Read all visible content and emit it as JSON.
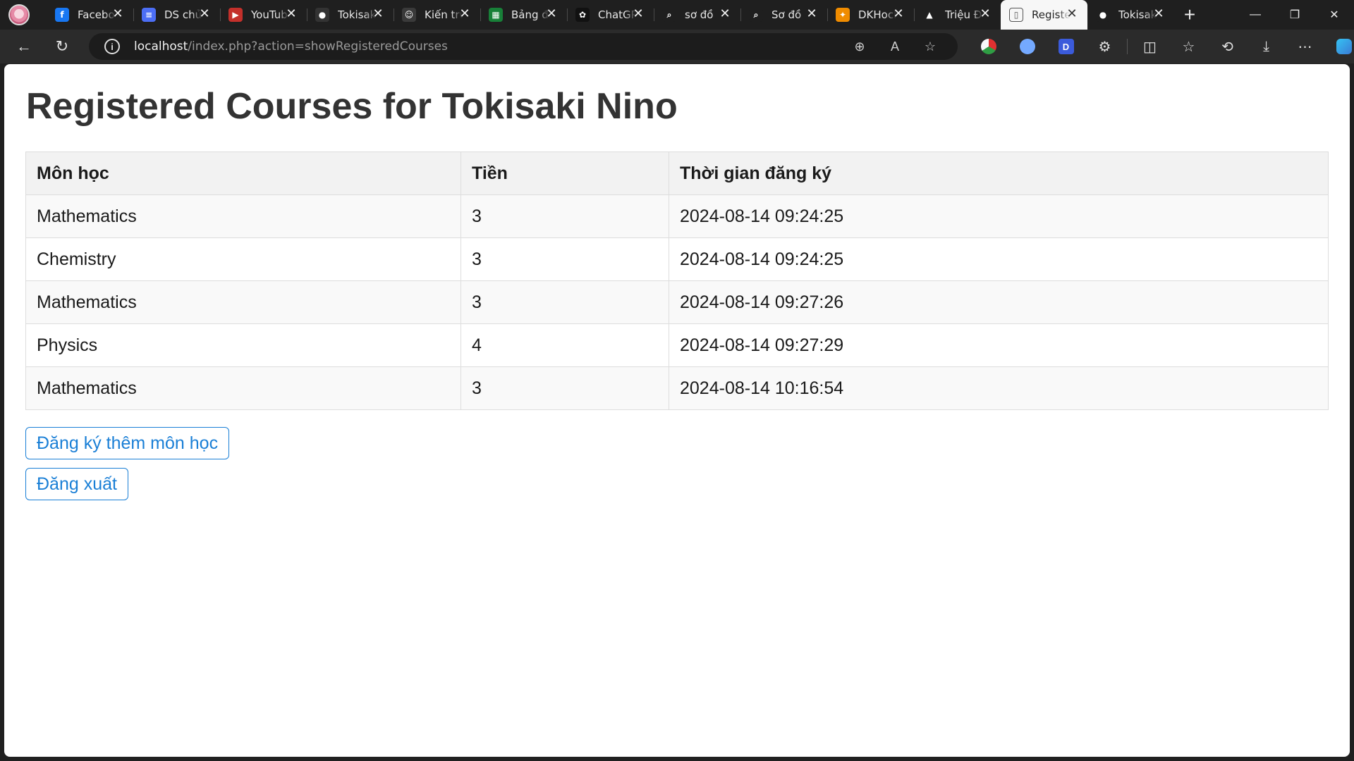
{
  "browser": {
    "tabs": [
      {
        "title": "Facebook",
        "icon": "facebook-icon",
        "color": "#1877f2",
        "glyph": "f"
      },
      {
        "title": "DS chủ",
        "icon": "docs-icon",
        "color": "#4c6ef5",
        "glyph": "≡"
      },
      {
        "title": "YouTube",
        "icon": "youtube-icon",
        "color": "#c4302b",
        "glyph": "▶"
      },
      {
        "title": "Tokisaki",
        "icon": "github-icon",
        "color": "#333333",
        "glyph": "●"
      },
      {
        "title": "Kiến trúc",
        "icon": "discord-icon",
        "color": "#3a3a3a",
        "glyph": "☺"
      },
      {
        "title": "Bảng điểm",
        "icon": "sheets-icon",
        "color": "#188038",
        "glyph": "▦"
      },
      {
        "title": "ChatGPT",
        "icon": "chatgpt-icon",
        "color": "#111111",
        "glyph": "✿"
      },
      {
        "title": "sơ đồ",
        "icon": "search-icon",
        "color": "#1f1f1f",
        "glyph": "⌕"
      },
      {
        "title": "Sơ đồ",
        "icon": "search-icon",
        "color": "#1f1f1f",
        "glyph": "⌕"
      },
      {
        "title": "DKHocPhan",
        "icon": "dkhp-icon",
        "color": "#f08c00",
        "glyph": "✦"
      },
      {
        "title": "Triệu Đô",
        "icon": "drive-icon",
        "color": "#1f1f1f",
        "glyph": "▲"
      },
      {
        "title": "Registered",
        "icon": "page-icon",
        "color": "#f7f7f7",
        "glyph": "▯",
        "active": true
      },
      {
        "title": "Tokisaki",
        "icon": "github-icon",
        "color": "#1f1f1f",
        "glyph": "●"
      }
    ],
    "address": {
      "host": "localhost",
      "path": "/index.php?action=showRegisteredCourses"
    }
  },
  "page": {
    "title": "Registered Courses for Tokisaki Nino",
    "table": {
      "headers": [
        "Môn học",
        "Tiền",
        "Thời gian đăng ký"
      ],
      "rows": [
        [
          "Mathematics",
          "3",
          "2024-08-14 09:24:25"
        ],
        [
          "Chemistry",
          "3",
          "2024-08-14 09:24:25"
        ],
        [
          "Mathematics",
          "3",
          "2024-08-14 09:27:26"
        ],
        [
          "Physics",
          "4",
          "2024-08-14 09:27:29"
        ],
        [
          "Mathematics",
          "3",
          "2024-08-14 10:16:54"
        ]
      ]
    },
    "buttons": {
      "register_more": "Đăng ký thêm môn học",
      "logout": "Đăng xuất"
    }
  },
  "colors": {
    "accent": "#1a7fd6",
    "header_bg": "#f2f2f2",
    "stripe_bg": "#f9f9f9"
  }
}
